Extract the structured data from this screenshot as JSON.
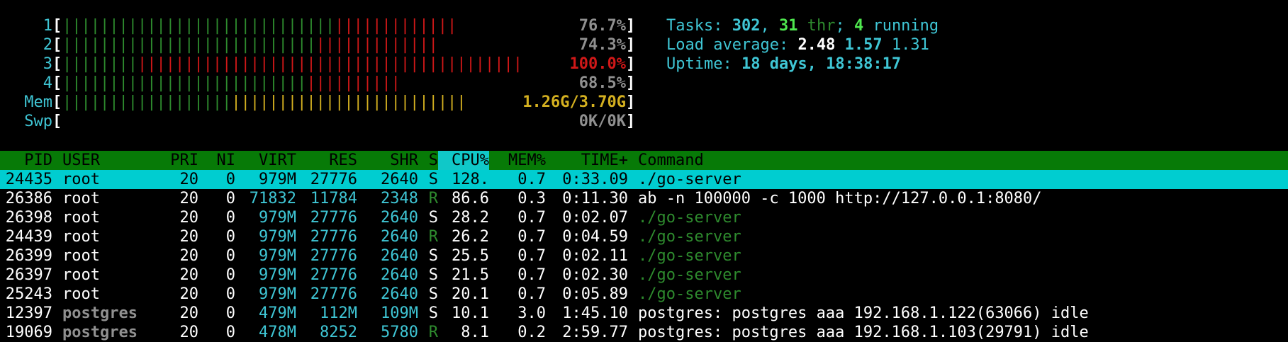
{
  "meters": [
    {
      "label": "1",
      "value": "76.7%",
      "segments": [
        {
          "color": "green",
          "text": "|||||||||||||||||||||||||||||"
        },
        {
          "color": "red",
          "text": "|||||||||||||"
        }
      ]
    },
    {
      "label": "2",
      "value": "74.3%",
      "segments": [
        {
          "color": "green",
          "text": "|||||||||||||||||||||||||||"
        },
        {
          "color": "red",
          "text": "|||||||||||||"
        }
      ]
    },
    {
      "label": "3",
      "value": "100.0%",
      "value_color": "red",
      "segments": [
        {
          "color": "green",
          "text": "||||||||"
        },
        {
          "color": "red",
          "text": "|||||||||||||||||||||||||||||||||||||||||"
        }
      ]
    },
    {
      "label": "4",
      "value": "68.5%",
      "segments": [
        {
          "color": "green",
          "text": "||||||||||||||||||||||||||"
        },
        {
          "color": "red",
          "text": "||||||||||"
        }
      ]
    },
    {
      "label": "Mem",
      "value": "1.26G/3.70G",
      "value_color": "yellow",
      "segments": [
        {
          "color": "green",
          "text": "||||||||||||||||||"
        },
        {
          "color": "yellow",
          "text": "|||||||||||||||||||||||||"
        }
      ]
    },
    {
      "label": "Swp",
      "value": "0K/0K",
      "segments": []
    }
  ],
  "sysinfo": {
    "tasks_label": "Tasks: ",
    "tasks": "302",
    "thr_count": "31",
    "thr_label": " thr",
    "running_count": "4",
    "running_label": " running",
    "load_label": "Load average: ",
    "load1": "2.48",
    "load5": "1.57",
    "load15": "1.31",
    "uptime_label": "Uptime: ",
    "uptime": "18 days, 18:38:17"
  },
  "columns": {
    "pid": "PID",
    "user": "USER",
    "pri": "PRI",
    "ni": "NI",
    "virt": "VIRT",
    "res": "RES",
    "shr": "SHR",
    "s": "S",
    "cpu": "CPU%",
    "mem": "MEM%",
    "time": "TIME+",
    "cmd": "Command"
  },
  "processes": [
    {
      "pid": "24435",
      "user": "root",
      "pri": "20",
      "ni": "0",
      "virt": "979M",
      "res": "27776",
      "shr": "2640",
      "s": "S",
      "cpu": "128.",
      "mem": "0.7",
      "time": "0:33.09",
      "cmd": "./go-server",
      "selected": true
    },
    {
      "pid": "26386",
      "user": "root",
      "pri": "20",
      "ni": "0",
      "virt": "71832",
      "res": "11784",
      "shr": "2348",
      "s": "R",
      "cpu": "86.6",
      "mem": "0.3",
      "time": "0:11.30",
      "cmd": "ab -n 100000 -c 1000 http://127.0.0.1:8080/"
    },
    {
      "pid": "26398",
      "user": "root",
      "pri": "20",
      "ni": "0",
      "virt": "979M",
      "res": "27776",
      "shr": "2640",
      "s": "S",
      "cpu": "28.2",
      "mem": "0.7",
      "time": "0:02.07",
      "cmd": "./go-server",
      "thread": true
    },
    {
      "pid": "24439",
      "user": "root",
      "pri": "20",
      "ni": "0",
      "virt": "979M",
      "res": "27776",
      "shr": "2640",
      "s": "R",
      "cpu": "26.2",
      "mem": "0.7",
      "time": "0:04.59",
      "cmd": "./go-server",
      "thread": true
    },
    {
      "pid": "26399",
      "user": "root",
      "pri": "20",
      "ni": "0",
      "virt": "979M",
      "res": "27776",
      "shr": "2640",
      "s": "S",
      "cpu": "25.5",
      "mem": "0.7",
      "time": "0:02.11",
      "cmd": "./go-server",
      "thread": true
    },
    {
      "pid": "26397",
      "user": "root",
      "pri": "20",
      "ni": "0",
      "virt": "979M",
      "res": "27776",
      "shr": "2640",
      "s": "S",
      "cpu": "21.5",
      "mem": "0.7",
      "time": "0:02.30",
      "cmd": "./go-server",
      "thread": true
    },
    {
      "pid": "25243",
      "user": "root",
      "pri": "20",
      "ni": "0",
      "virt": "979M",
      "res": "27776",
      "shr": "2640",
      "s": "S",
      "cpu": "20.1",
      "mem": "0.7",
      "time": "0:05.89",
      "cmd": "./go-server",
      "thread": true
    },
    {
      "pid": "12397",
      "user": "postgres",
      "pri": "20",
      "ni": "0",
      "virt": "479M",
      "res": "112M",
      "shr": "109M",
      "s": "S",
      "cpu": "10.1",
      "mem": "3.0",
      "time": "1:45.10",
      "cmd": "postgres: postgres aaa 192.168.1.122(63066) idle",
      "gray_user": true
    },
    {
      "pid": "19069",
      "user": "postgres",
      "pri": "20",
      "ni": "0",
      "virt": "478M",
      "res": "8252",
      "shr": "5780",
      "s": "R",
      "cpu": "8.1",
      "mem": "0.2",
      "time": "2:59.77",
      "cmd": "postgres: postgres aaa 192.168.1.103(29791) idle",
      "gray_user": true
    }
  ],
  "colors": {
    "green": "#2e8b2e",
    "red": "#d01818",
    "yellow": "#d4b020",
    "cyan": "#3fc6d5",
    "header_bg": "#077a07",
    "selected_bg": "#00cdd0"
  }
}
